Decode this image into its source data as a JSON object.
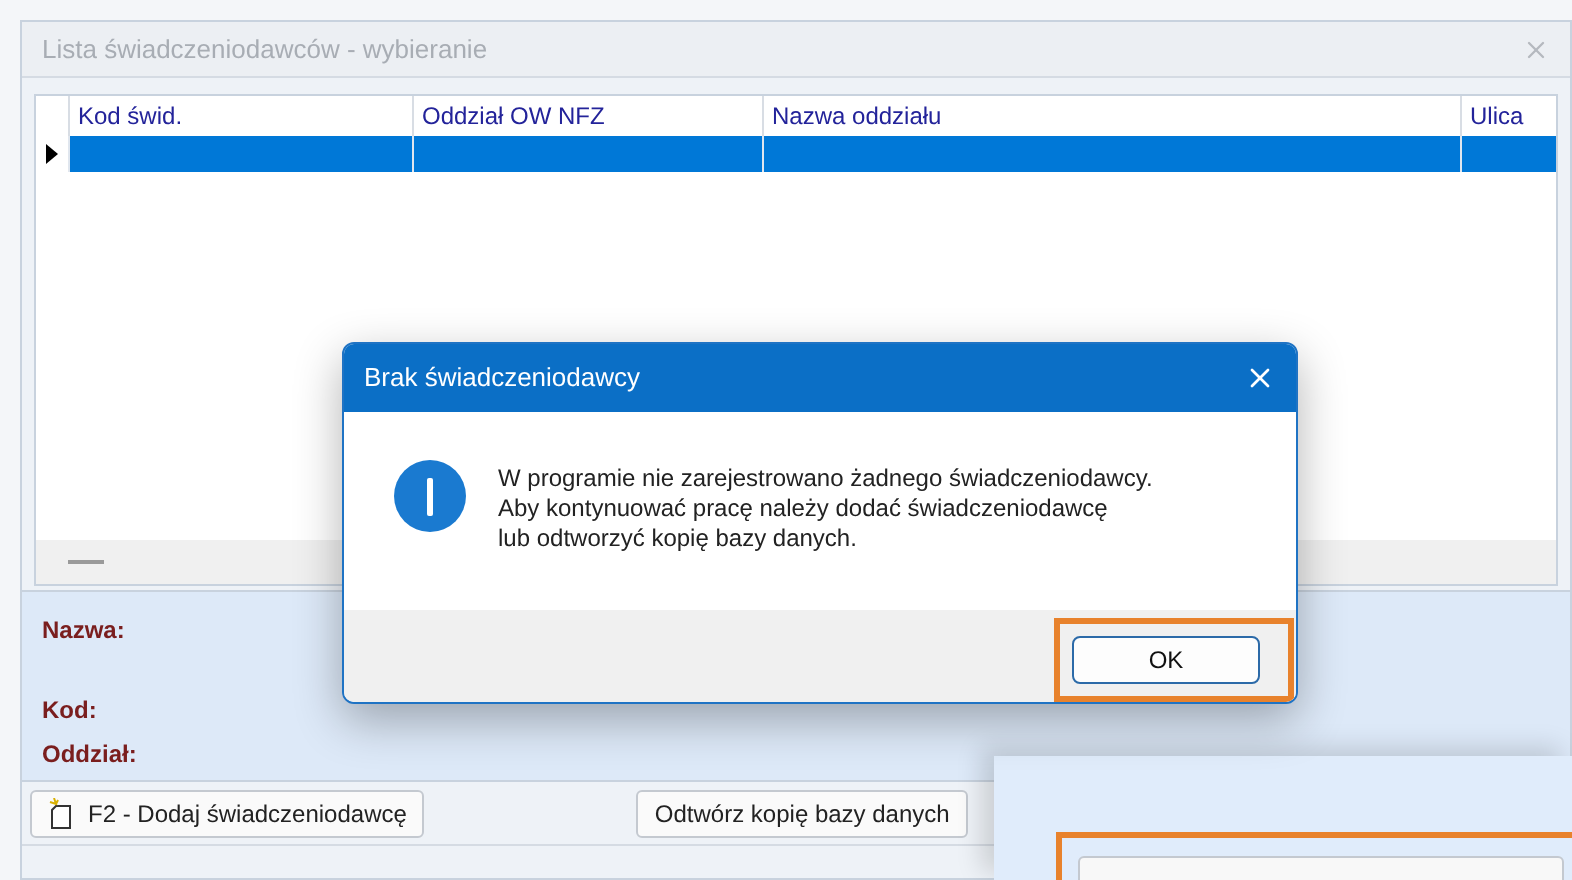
{
  "window": {
    "title": "Lista świadczeniodawców - wybieranie"
  },
  "table": {
    "columns": [
      "Kod świd.",
      "Oddział OW NFZ",
      "Nazwa oddziału",
      "Ulica"
    ],
    "rows": [
      {
        "selected": true
      }
    ]
  },
  "details": {
    "labels": [
      "Nazwa:",
      "Kod:",
      "Oddział:"
    ]
  },
  "buttons": [
    {
      "label": "F2 - Dodaj świadczeniodawcę",
      "kind": "new"
    },
    {
      "label": "Odtwórz kopię bazy danych",
      "kind": "plain"
    }
  ],
  "dialog": {
    "title": "Brak świadczeniodawcy",
    "message": [
      "W programie nie zarejestrowano żadnego świadczeniodawcy.",
      "Aby kontynuować pracę należy dodać świadczeniodawcę",
      "lub odtworzyć kopię bazy danych."
    ],
    "ok": {
      "label": "OK",
      "highlighted": true
    }
  },
  "overlay_panel": {
    "button_highlighted": true
  }
}
